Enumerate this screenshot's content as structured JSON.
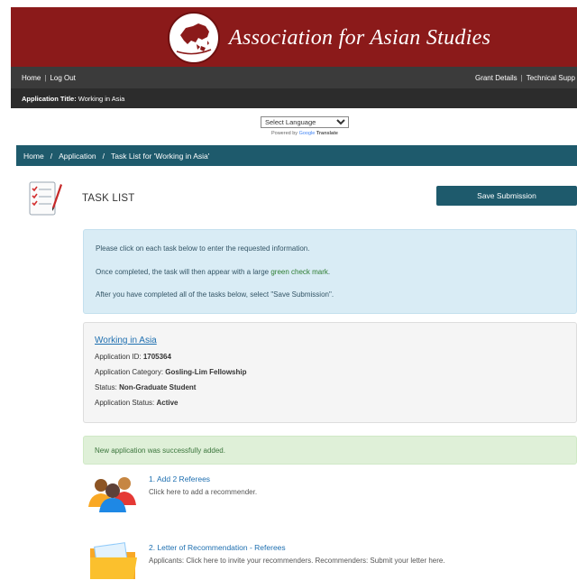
{
  "header": {
    "org_name": "Association for Asian Studies"
  },
  "topnav": {
    "home": "Home",
    "logout": "Log Out",
    "grant_details": "Grant Details",
    "technical_support": "Technical Supp"
  },
  "application_title": {
    "label": "Application Title:",
    "value": "Working in Asia"
  },
  "language": {
    "select_label": "Select Language",
    "powered_by": "Powered by",
    "google": "Google",
    "translate": "Translate"
  },
  "breadcrumb": {
    "home": "Home",
    "application": "Application",
    "current": "Task List for 'Working in Asia'"
  },
  "page_title": "TASK LIST",
  "save_button": "Save Submission",
  "info": {
    "line1": "Please click on each task below to enter the requested information.",
    "line2_pre": "Once completed, the task will then appear with a large ",
    "line2_green": "green check mark",
    "line2_post": ".",
    "line3": "After you have completed all of the tasks below, select \"Save Submission\"."
  },
  "details": {
    "app_name": "Working in Asia",
    "id_label": "Application ID: ",
    "id_value": "1705364",
    "category_label": "Application Category: ",
    "category_value": "Gosling-Lim Fellowship",
    "status_label": "Status: ",
    "status_value": "Non-Graduate Student",
    "app_status_label": "Application Status: ",
    "app_status_value": "Active"
  },
  "success_message": "New application was successfully added.",
  "tasks": [
    {
      "name": "1. Add 2 Referees",
      "desc": "Click here to add a recommender.",
      "icon": "people-group-icon"
    },
    {
      "name": "2. Letter of Recommendation - Referees",
      "desc": "Applicants: Click here to invite your recommenders. Recommenders: Submit your letter here.",
      "icon": "folder-icon"
    }
  ],
  "colors": {
    "banner": "#8b1a1a",
    "nav": "#3b3b3b",
    "teal": "#1e5a6c",
    "info_bg": "#d9ecf5",
    "success_bg": "#dff0d8",
    "link": "#1e6fb0"
  }
}
